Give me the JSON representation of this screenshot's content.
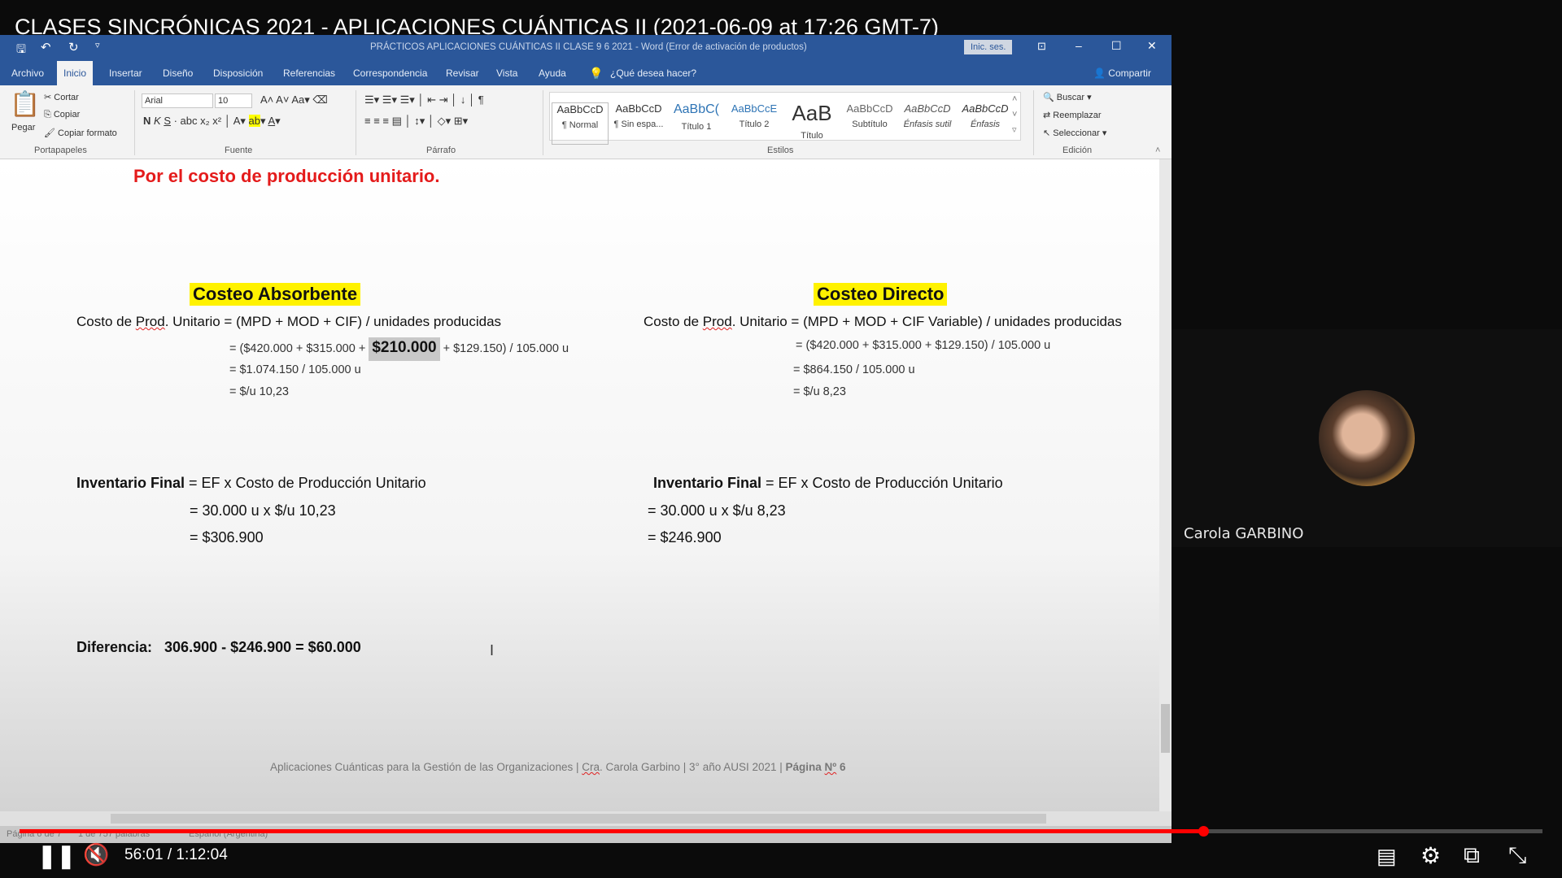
{
  "video": {
    "title": "CLASES SINCRÓNICAS 2021 - APLICACIONES CUÁNTICAS II (2021-06-09 at 17:26 GMT-7)",
    "time": "56:01 / 1:12:04",
    "progress_fraction": 0.777,
    "accent": "#ff0000"
  },
  "word": {
    "window_title": "PRÁCTICOS APLICACIONES CUÁNTICAS II  CLASE 9 6 2021  -  Word (Error de activación de productos)",
    "signin": "Inic. ses.",
    "tabs": [
      "Archivo",
      "Inicio",
      "Insertar",
      "Diseño",
      "Disposición",
      "Referencias",
      "Correspondencia",
      "Revisar",
      "Vista",
      "Ayuda"
    ],
    "tell_me": "¿Qué desea hacer?",
    "share": "Compartir",
    "clipboard": {
      "paste": "Pegar",
      "cut": "Cortar",
      "copy": "Copiar",
      "format": "Copiar formato",
      "group": "Portapapeles"
    },
    "font": {
      "name": "Arial",
      "size": "10",
      "group": "Fuente"
    },
    "paragraph_group": "Párrafo",
    "styles": [
      {
        "sample": "AaBbCcD",
        "label": "¶ Normal"
      },
      {
        "sample": "AaBbCcD",
        "label": "¶ Sin espa..."
      },
      {
        "sample": "AaBbC(",
        "label": "Título 1"
      },
      {
        "sample": "AaBbCcE",
        "label": "Título 2"
      },
      {
        "sample": "AaB",
        "label": "Título"
      },
      {
        "sample": "AaBbCcD",
        "label": "Subtítulo"
      },
      {
        "sample": "AaBbCcD",
        "label": "Énfasis sutil"
      },
      {
        "sample": "AaBbCcD",
        "label": "Énfasis"
      }
    ],
    "styles_group": "Estilos",
    "editing": {
      "find": "Buscar",
      "replace": "Reemplazar",
      "select": "Seleccionar",
      "group": "Edición"
    },
    "status": {
      "page": "Página 6 de 7",
      "words": "1 de 757 palabras",
      "language": "Español (Argentina)"
    },
    "brand_color": "#2b579a"
  },
  "document": {
    "heading": "Por el costo de producción unitario.",
    "left": {
      "title": "Costeo Absorbente",
      "formula_pre": "Costo de ",
      "formula_sq": "Prod",
      "formula_post": ". Unitario = (MPD + MOD + CIF) / unidades producidas",
      "l1a": "= ($420.000 + $315.000 + ",
      "l1b": "$210.000",
      "l1c": " + $129.150) / 105.000 u",
      "l2": "= $1.074.150 / 105.000 u",
      "l3": "= $/u 10,23",
      "inv_bold": "Inventario Final",
      "inv_rest": " = EF x Costo de Producción Unitario",
      "inv1": "= 30.000 u x $/u 10,23",
      "inv2": "= $306.900"
    },
    "right": {
      "title": "Costeo Directo",
      "formula_pre": "Costo de ",
      "formula_sq": "Prod",
      "formula_post": ". Unitario = (MPD + MOD + CIF Variable) / unidades producidas",
      "l1": "= ($420.000 + $315.000 + $129.150) / 105.000 u",
      "l2": "= $864.150 / 105.000 u",
      "l3": "= $/u 8,23",
      "inv_bold": "Inventario Final",
      "inv_rest": " = EF x Costo de Producción Unitario",
      "inv1": "= 30.000 u x $/u 8,23",
      "inv2": "= $246.900"
    },
    "difference": "Diferencia:   306.900 - $246.900 = $60.000",
    "footer": {
      "a": "Aplicaciones Cuánticas para la Gestión de las Organizaciones | ",
      "b": "Cra",
      "c": ". Carola Garbino | 3° año AUSI 2021 | ",
      "d": "Página ",
      "e": "Nº",
      "f": " 6"
    }
  },
  "participant": {
    "name": "Carola GARBINO"
  }
}
